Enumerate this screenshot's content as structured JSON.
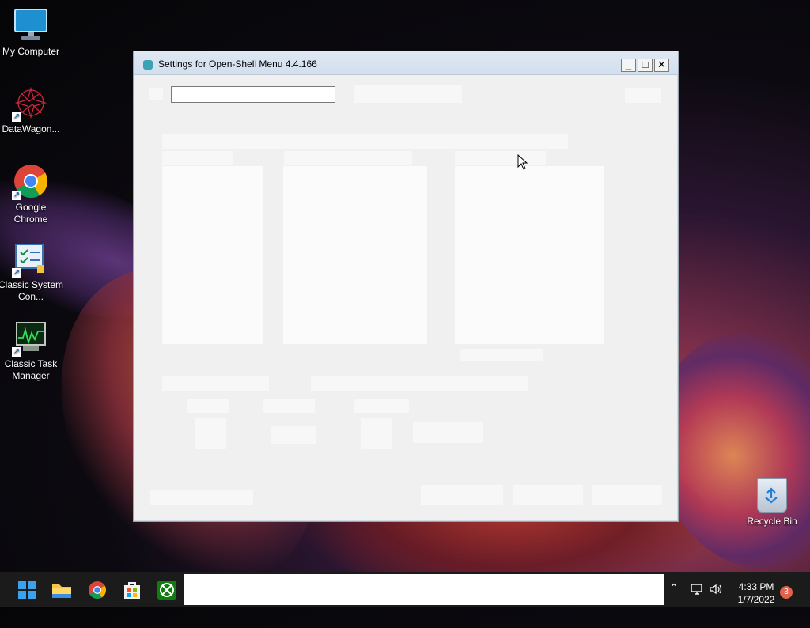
{
  "desktop": {
    "icons": [
      {
        "label": "My Computer",
        "icon": "monitor-icon"
      },
      {
        "label": "DataWagon...",
        "icon": "datawagon-icon"
      },
      {
        "label": "Google Chrome",
        "icon": "chrome-icon"
      },
      {
        "label": "Classic System Con...",
        "icon": "control-panel-icon"
      },
      {
        "label": "Classic Task Manager",
        "icon": "task-manager-icon"
      }
    ],
    "recycle_bin": {
      "label": "Recycle Bin",
      "icon": "recycle-bin-icon"
    }
  },
  "window": {
    "title": "Settings for Open-Shell Menu 4.4.166",
    "controls": {
      "minimize": "_",
      "maximize": "□",
      "close": "✕"
    },
    "search": {
      "value": "",
      "placeholder": ""
    }
  },
  "taskbar": {
    "apps": [
      {
        "name": "Start",
        "icon": "windows-start-icon"
      },
      {
        "name": "File Explorer",
        "icon": "folder-icon"
      },
      {
        "name": "Google Chrome",
        "icon": "chrome-icon"
      },
      {
        "name": "Microsoft Store",
        "icon": "store-icon"
      },
      {
        "name": "Xbox",
        "icon": "xbox-icon"
      }
    ],
    "clock": {
      "time": "4:33 PM",
      "date": "1/7/2022"
    },
    "notifications": "3"
  },
  "colors": {
    "accent": "#0078d4",
    "taskbar": "#1b1b1b",
    "window_bg": "#f0f0f0"
  }
}
